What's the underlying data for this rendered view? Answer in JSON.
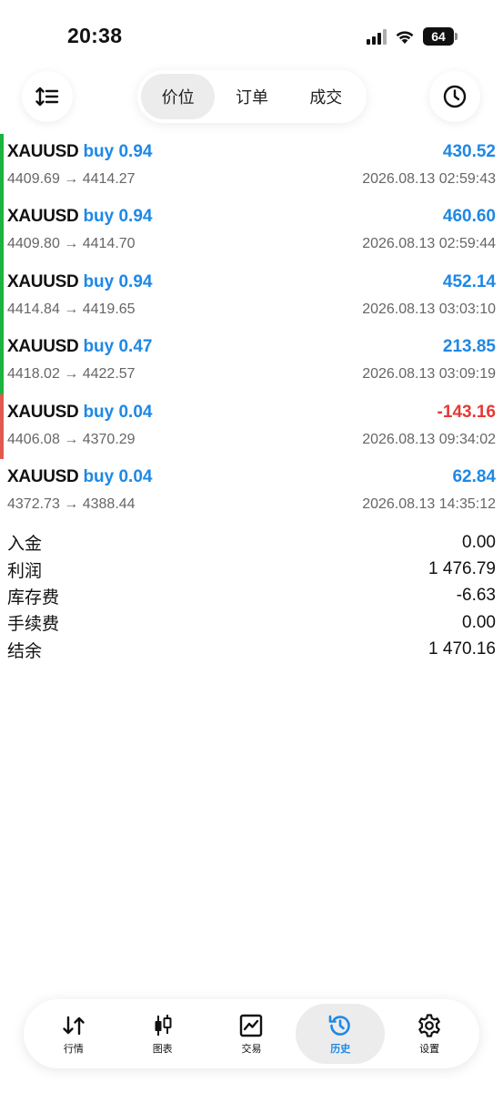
{
  "status_bar": {
    "time": "20:38",
    "battery": "64"
  },
  "tabs_top": [
    {
      "label": "价位",
      "active": true
    },
    {
      "label": "订单",
      "active": false
    },
    {
      "label": "成交",
      "active": false
    }
  ],
  "deals": [
    {
      "symbol": "XAUUSD",
      "side_volume": "buy 0.94",
      "prices": "4409.69 → 4414.27",
      "profit": "430.52",
      "time": "2026.08.13 02:59:43",
      "status_color": "#1db33f"
    },
    {
      "symbol": "XAUUSD",
      "side_volume": "buy 0.94",
      "prices": "4409.80 → 4414.70",
      "profit": "460.60",
      "time": "2026.08.13 02:59:44",
      "status_color": "#1db33f"
    },
    {
      "symbol": "XAUUSD",
      "side_volume": "buy 0.94",
      "prices": "4414.84 → 4419.65",
      "profit": "452.14",
      "time": "2026.08.13 03:03:10",
      "status_color": "#1db33f"
    },
    {
      "symbol": "XAUUSD",
      "side_volume": "buy 0.47",
      "prices": "4418.02 → 4422.57",
      "profit": "213.85",
      "time": "2026.08.13 03:09:19",
      "status_color": "#1db33f"
    },
    {
      "symbol": "XAUUSD",
      "side_volume": "buy 0.04",
      "prices": "4406.08 → 4370.29",
      "profit": "-143.16",
      "time": "2026.08.13 09:34:02",
      "status_color": "#e05a4e"
    },
    {
      "symbol": "XAUUSD",
      "side_volume": "buy 0.04",
      "prices": "4372.73 → 4388.44",
      "profit": "62.84",
      "time": "2026.08.13 14:35:12",
      "status_color": ""
    }
  ],
  "summary": [
    {
      "label": "入金",
      "value": "0.00"
    },
    {
      "label": "利润",
      "value": "1 476.79"
    },
    {
      "label": "库存费",
      "value": "-6.63"
    },
    {
      "label": "手续费",
      "value": "0.00"
    },
    {
      "label": "结余",
      "value": "1 470.16"
    }
  ],
  "bottom_tabs": [
    {
      "label": "行情",
      "icon": "quotes-arrows-icon",
      "active": false
    },
    {
      "label": "图表",
      "icon": "candlestick-chart-icon",
      "active": false
    },
    {
      "label": "交易",
      "icon": "trade-chart-icon",
      "active": false
    },
    {
      "label": "历史",
      "icon": "history-clock-icon",
      "active": true
    },
    {
      "label": "设置",
      "icon": "gear-icon",
      "active": false
    }
  ],
  "colors": {
    "accent": "#1e88e5",
    "negative": "#e53935",
    "profit_bar": "#1db33f",
    "loss_bar": "#e05a4e"
  }
}
